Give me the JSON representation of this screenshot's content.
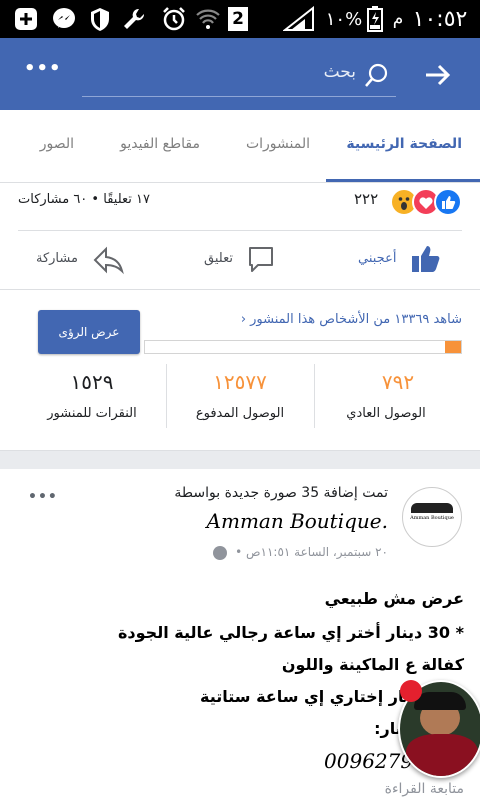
{
  "status_bar": {
    "time": "١٠:٥٢",
    "period": "م",
    "battery": "١٠%",
    "sim_count": "2",
    "icons": [
      "add-icon",
      "messenger-icon",
      "shield-icon",
      "wrench-icon",
      "alarm-icon",
      "wifi-icon",
      "sim-icon",
      "signal-icon",
      "battery-icon"
    ]
  },
  "app_bar": {
    "search_placeholder": "بحث",
    "more_label": "•••",
    "back_icon": "arrow-forward-icon"
  },
  "tabs": [
    "الصفحة الرئيسية",
    "المنشورات",
    "مقاطع الفيديو",
    "الصور"
  ],
  "reactions": {
    "count": "٢٢٢",
    "summary": "١٧ تعليقًا • ٦٠ مشاركات",
    "icons": [
      "like-icon",
      "love-icon",
      "wow-icon"
    ]
  },
  "actions": {
    "like": "أعجبني",
    "comment": "تعليق",
    "share": "مشاركة"
  },
  "insights": {
    "seen_by": "شاهد ١٣٣٦٩ من الأشخاص هذا المنشور",
    "view_insights": "عرض الرؤى",
    "organic_fraction": 0.05,
    "paid_fraction": 0.95,
    "stats": [
      {
        "value": "٧٩٢",
        "label": "الوصول العادي",
        "color": "#f7923a"
      },
      {
        "value": "١٢٥٧٧",
        "label": "الوصول المدفوع",
        "color": "#f7923a"
      },
      {
        "value": "١٥٢٩",
        "label": "النقرات للمنشور",
        "color": "#1c1e21"
      }
    ]
  },
  "post": {
    "header": "تمت إضافة 35 صورة جديدة بواسطة",
    "page_name": ".Amman Boutique",
    "avatar_text": "Amman Boutique",
    "time": "٢٠ سبتمبر، الساعة ١١:٥١ص •",
    "more": "•••",
    "lines": [
      "عرض مش طبيعي",
      "* 30 دينار أختر إي ساعة رجالي عالية الجودة",
      "كفالة ع الماكينة واللون",
      "| 20 دينار إختاري إي ساعة ستاتية",
      "للاستفسار:",
      "00962797417",
      "متابعة القراءة"
    ]
  },
  "colors": {
    "brand": "#4267b2",
    "accent_orange": "#f7923a"
  }
}
